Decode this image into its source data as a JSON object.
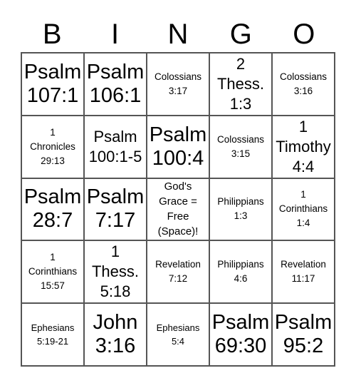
{
  "header": {
    "letters": [
      "B",
      "I",
      "N",
      "G",
      "O"
    ]
  },
  "grid": {
    "rows": [
      [
        {
          "text": "Psalm\n107:1",
          "size": "xl"
        },
        {
          "text": "Psalm\n106:1",
          "size": "xl"
        },
        {
          "text": "Colossians\n3:17",
          "size": "s"
        },
        {
          "text": "2\nThess.\n1:3",
          "size": "l"
        },
        {
          "text": "Colossians\n3:16",
          "size": "s"
        }
      ],
      [
        {
          "text": "1\nChronicles\n29:13",
          "size": "s"
        },
        {
          "text": "Psalm\n100:1-5",
          "size": "l"
        },
        {
          "text": "Psalm\n100:4",
          "size": "xl"
        },
        {
          "text": "Colossians\n3:15",
          "size": "s"
        },
        {
          "text": "1\nTimothy\n4:4",
          "size": "l"
        }
      ],
      [
        {
          "text": "Psalm\n28:7",
          "size": "xl"
        },
        {
          "text": "Psalm\n7:17",
          "size": "xl"
        },
        {
          "text": "God's\nGrace =\nFree\n(Space)!",
          "size": "m",
          "free_space": true
        },
        {
          "text": "Philippians\n1:3",
          "size": "s"
        },
        {
          "text": "1\nCorinthians\n1:4",
          "size": "s"
        }
      ],
      [
        {
          "text": "1\nCorinthians\n15:57",
          "size": "s"
        },
        {
          "text": "1\nThess.\n5:18",
          "size": "l"
        },
        {
          "text": "Revelation\n7:12",
          "size": "s"
        },
        {
          "text": "Philippians\n4:6",
          "size": "s"
        },
        {
          "text": "Revelation\n11:17",
          "size": "s"
        }
      ],
      [
        {
          "text": "Ephesians\n5:19-21",
          "size": "xs"
        },
        {
          "text": "John\n3:16",
          "size": "xl"
        },
        {
          "text": "Ephesians\n5:4",
          "size": "xs"
        },
        {
          "text": "Psalm\n69:30",
          "size": "xl"
        },
        {
          "text": "Psalm\n95:2",
          "size": "xl"
        }
      ]
    ]
  },
  "colors": {
    "grid_line": "#555555",
    "text": "#000000",
    "background": "#ffffff"
  }
}
